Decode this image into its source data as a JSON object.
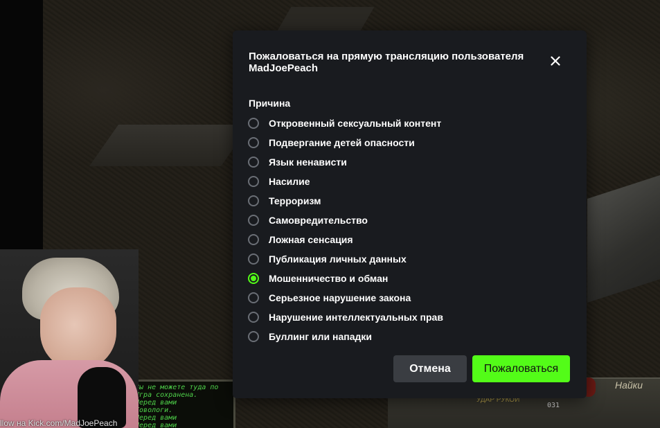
{
  "colors": {
    "accent": "#53fc18",
    "modal_bg": "#191b1f",
    "cancel_bg": "#3a3d42",
    "radio_border": "#6a6e75"
  },
  "background": {
    "watermark": "llow на Kick.com/MadJoePeach",
    "console_lines": [
      "•Вы не можете туда по",
      "•Игра сохранена.",
      "•Перед вами",
      "•Ковологи.",
      "•Перед вами",
      "•Перед вами"
    ],
    "hud_label": "УДАР РУКОЙ",
    "hud_logo": "Найки",
    "hud_digits": "031"
  },
  "modal": {
    "title": "Пожаловаться на прямую трансляцию пользователя MadJoePeach",
    "close_icon": "close-icon",
    "reason_label": "Причина",
    "options": [
      {
        "label": "Откровенный сексуальный контент",
        "checked": false
      },
      {
        "label": "Подвергание детей опасности",
        "checked": false
      },
      {
        "label": "Язык ненависти",
        "checked": false
      },
      {
        "label": "Насилие",
        "checked": false
      },
      {
        "label": "Терроризм",
        "checked": false
      },
      {
        "label": "Самовредительство",
        "checked": false
      },
      {
        "label": "Ложная сенсация",
        "checked": false
      },
      {
        "label": "Публикация личных данных",
        "checked": false
      },
      {
        "label": "Мошенничество и обман",
        "checked": true
      },
      {
        "label": "Серьезное нарушение закона",
        "checked": false
      },
      {
        "label": "Нарушение интеллектуальных прав",
        "checked": false
      },
      {
        "label": "Буллинг или нападки",
        "checked": false
      }
    ],
    "cancel_label": "Отмена",
    "report_label": "Пожаловаться"
  }
}
